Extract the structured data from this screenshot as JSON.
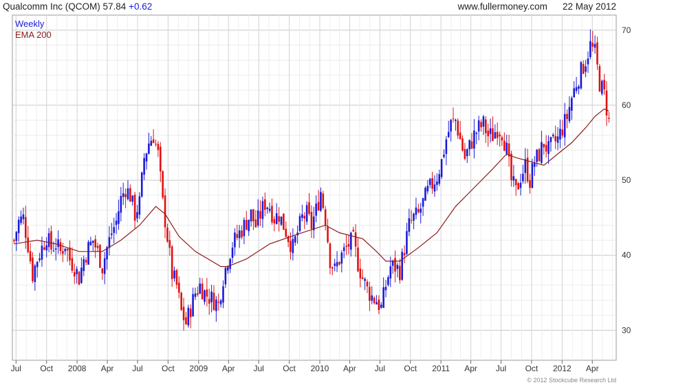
{
  "header": {
    "symbol_title": "Qualcomm Inc (QCOM)",
    "last_price": "57.84",
    "change": "+0.62",
    "site": "www.fullermoney.com",
    "date": "22 May 2012"
  },
  "copyright": "© 2012 Stockcube Research Ltd",
  "colors": {
    "up": "#1a1ad8",
    "down": "#e01010",
    "ema": "#8b1a1a",
    "grid": "#dcdcdc",
    "border": "#999999"
  },
  "chart_data": {
    "type": "candlestick",
    "legend": [
      {
        "label": "Weekly",
        "color": "#1a1ad8"
      },
      {
        "label": "EMA 200",
        "color": "#8b1a1a"
      }
    ],
    "legend_position": "top-left",
    "y_axis": {
      "position": "right",
      "min": 26,
      "max": 72,
      "ticks": [
        30,
        40,
        50,
        60,
        70
      ]
    },
    "x_axis": {
      "start": "2007-06-20",
      "end": "2012-06-12",
      "ticks": [
        {
          "date": "2007-07-01",
          "label": "Jul"
        },
        {
          "date": "2007-10-01",
          "label": "Oct"
        },
        {
          "date": "2008-01-01",
          "label": "2008"
        },
        {
          "date": "2008-04-01",
          "label": "Apr"
        },
        {
          "date": "2008-07-01",
          "label": "Jul"
        },
        {
          "date": "2008-10-01",
          "label": "Oct"
        },
        {
          "date": "2009-01-01",
          "label": "2009"
        },
        {
          "date": "2009-04-01",
          "label": "Apr"
        },
        {
          "date": "2009-07-01",
          "label": "Jul"
        },
        {
          "date": "2009-10-01",
          "label": "Oct"
        },
        {
          "date": "2010-01-01",
          "label": "2010"
        },
        {
          "date": "2010-04-01",
          "label": "Apr"
        },
        {
          "date": "2010-07-01",
          "label": "Jul"
        },
        {
          "date": "2010-10-01",
          "label": "Oct"
        },
        {
          "date": "2011-01-01",
          "label": "2011"
        },
        {
          "date": "2011-04-01",
          "label": "Apr"
        },
        {
          "date": "2011-07-01",
          "label": "Jul"
        },
        {
          "date": "2011-10-01",
          "label": "Oct"
        },
        {
          "date": "2012-01-01",
          "label": "2012"
        },
        {
          "date": "2012-04-01",
          "label": "Apr"
        }
      ]
    },
    "price_series": [
      [
        "2007-06-25",
        42.0
      ],
      [
        "2007-07-09",
        44.5
      ],
      [
        "2007-07-23",
        45.0
      ],
      [
        "2007-08-06",
        41.5
      ],
      [
        "2007-08-20",
        37.5
      ],
      [
        "2007-09-03",
        39.5
      ],
      [
        "2007-09-17",
        41.0
      ],
      [
        "2007-10-01",
        42.5
      ],
      [
        "2007-10-15",
        41.0
      ],
      [
        "2007-10-29",
        41.5
      ],
      [
        "2007-11-12",
        40.5
      ],
      [
        "2007-11-26",
        41.5
      ],
      [
        "2007-12-10",
        39.5
      ],
      [
        "2007-12-24",
        38.5
      ],
      [
        "2008-01-07",
        37.0
      ],
      [
        "2008-01-21",
        39.5
      ],
      [
        "2008-02-04",
        41.0
      ],
      [
        "2008-02-18",
        42.0
      ],
      [
        "2008-03-03",
        40.5
      ],
      [
        "2008-03-17",
        38.5
      ],
      [
        "2008-03-31",
        41.0
      ],
      [
        "2008-04-14",
        43.0
      ],
      [
        "2008-04-28",
        44.5
      ],
      [
        "2008-05-12",
        47.5
      ],
      [
        "2008-05-26",
        49.0
      ],
      [
        "2008-06-09",
        48.0
      ],
      [
        "2008-06-23",
        45.5
      ],
      [
        "2008-07-07",
        47.0
      ],
      [
        "2008-07-21",
        53.0
      ],
      [
        "2008-08-04",
        55.0
      ],
      [
        "2008-08-18",
        56.0
      ],
      [
        "2008-09-01",
        53.5
      ],
      [
        "2008-09-15",
        47.0
      ],
      [
        "2008-09-29",
        42.5
      ],
      [
        "2008-10-13",
        37.5
      ],
      [
        "2008-10-27",
        36.0
      ],
      [
        "2008-11-10",
        32.5
      ],
      [
        "2008-11-24",
        31.0
      ],
      [
        "2008-12-08",
        33.0
      ],
      [
        "2008-12-22",
        35.0
      ],
      [
        "2009-01-05",
        36.0
      ],
      [
        "2009-01-19",
        35.0
      ],
      [
        "2009-02-02",
        34.5
      ],
      [
        "2009-02-16",
        34.0
      ],
      [
        "2009-03-02",
        33.5
      ],
      [
        "2009-03-16",
        37.0
      ],
      [
        "2009-03-30",
        39.5
      ],
      [
        "2009-04-13",
        41.5
      ],
      [
        "2009-04-27",
        42.5
      ],
      [
        "2009-05-11",
        43.5
      ],
      [
        "2009-05-25",
        44.5
      ],
      [
        "2009-06-08",
        45.5
      ],
      [
        "2009-06-22",
        44.0
      ],
      [
        "2009-07-06",
        45.5
      ],
      [
        "2009-07-20",
        47.0
      ],
      [
        "2009-08-03",
        46.5
      ],
      [
        "2009-08-17",
        45.0
      ],
      [
        "2009-08-31",
        45.5
      ],
      [
        "2009-09-14",
        44.0
      ],
      [
        "2009-09-28",
        42.5
      ],
      [
        "2009-10-12",
        41.0
      ],
      [
        "2009-10-26",
        43.0
      ],
      [
        "2009-11-09",
        45.0
      ],
      [
        "2009-11-23",
        45.5
      ],
      [
        "2009-12-07",
        44.0
      ],
      [
        "2009-12-21",
        46.0
      ],
      [
        "2010-01-04",
        48.5
      ],
      [
        "2010-01-18",
        45.0
      ],
      [
        "2010-02-01",
        39.5
      ],
      [
        "2010-02-15",
        38.0
      ],
      [
        "2010-03-01",
        39.5
      ],
      [
        "2010-03-15",
        40.5
      ],
      [
        "2010-03-29",
        41.5
      ],
      [
        "2010-04-12",
        42.0
      ],
      [
        "2010-04-26",
        39.0
      ],
      [
        "2010-05-10",
        37.0
      ],
      [
        "2010-05-24",
        35.5
      ],
      [
        "2010-06-07",
        34.5
      ],
      [
        "2010-06-21",
        34.0
      ],
      [
        "2010-07-05",
        33.0
      ],
      [
        "2010-07-19",
        36.0
      ],
      [
        "2010-08-02",
        38.5
      ],
      [
        "2010-08-16",
        38.5
      ],
      [
        "2010-08-30",
        38.0
      ],
      [
        "2010-09-13",
        41.0
      ],
      [
        "2010-09-27",
        44.0
      ],
      [
        "2010-10-11",
        45.0
      ],
      [
        "2010-10-25",
        45.5
      ],
      [
        "2010-11-08",
        47.0
      ],
      [
        "2010-11-22",
        48.5
      ],
      [
        "2010-12-06",
        49.5
      ],
      [
        "2010-12-20",
        50.5
      ],
      [
        "2011-01-03",
        52.5
      ],
      [
        "2011-01-17",
        55.5
      ],
      [
        "2011-01-31",
        57.5
      ],
      [
        "2011-02-14",
        58.0
      ],
      [
        "2011-02-28",
        55.5
      ],
      [
        "2011-03-14",
        53.0
      ],
      [
        "2011-03-28",
        54.5
      ],
      [
        "2011-04-11",
        56.0
      ],
      [
        "2011-04-25",
        57.0
      ],
      [
        "2011-05-09",
        57.5
      ],
      [
        "2011-05-23",
        56.0
      ],
      [
        "2011-06-06",
        56.0
      ],
      [
        "2011-06-20",
        57.0
      ],
      [
        "2011-07-04",
        56.5
      ],
      [
        "2011-07-18",
        54.0
      ],
      [
        "2011-08-01",
        50.0
      ],
      [
        "2011-08-15",
        48.5
      ],
      [
        "2011-08-29",
        50.5
      ],
      [
        "2011-09-12",
        52.0
      ],
      [
        "2011-09-26",
        50.0
      ],
      [
        "2011-10-10",
        52.5
      ],
      [
        "2011-10-24",
        53.5
      ],
      [
        "2011-11-07",
        55.0
      ],
      [
        "2011-11-21",
        54.0
      ],
      [
        "2011-12-05",
        55.0
      ],
      [
        "2011-12-19",
        55.5
      ],
      [
        "2012-01-02",
        57.0
      ],
      [
        "2012-01-16",
        58.5
      ],
      [
        "2012-01-30",
        61.0
      ],
      [
        "2012-02-13",
        63.0
      ],
      [
        "2012-02-27",
        64.5
      ],
      [
        "2012-03-12",
        66.0
      ],
      [
        "2012-03-26",
        68.0
      ],
      [
        "2012-04-09",
        67.0
      ],
      [
        "2012-04-23",
        63.0
      ],
      [
        "2012-05-07",
        61.5
      ],
      [
        "2012-05-21",
        57.84
      ]
    ],
    "ema_series": [
      [
        "2007-06-25",
        41.5
      ],
      [
        "2007-09-03",
        42.0
      ],
      [
        "2007-10-29",
        41.5
      ],
      [
        "2008-01-07",
        40.5
      ],
      [
        "2008-03-17",
        40.5
      ],
      [
        "2008-05-12",
        42.0
      ],
      [
        "2008-07-07",
        44.0
      ],
      [
        "2008-08-25",
        46.5
      ],
      [
        "2008-09-22",
        45.5
      ],
      [
        "2008-11-03",
        42.5
      ],
      [
        "2008-12-22",
        40.5
      ],
      [
        "2009-03-09",
        38.5
      ],
      [
        "2009-03-30",
        38.5
      ],
      [
        "2009-05-25",
        39.5
      ],
      [
        "2009-08-03",
        41.5
      ],
      [
        "2009-10-26",
        42.8
      ],
      [
        "2010-01-18",
        44.0
      ],
      [
        "2010-03-01",
        43.0
      ],
      [
        "2010-05-10",
        42.2
      ],
      [
        "2010-06-21",
        40.5
      ],
      [
        "2010-07-19",
        39.2
      ],
      [
        "2010-08-30",
        39.2
      ],
      [
        "2010-10-25",
        41.0
      ],
      [
        "2010-12-20",
        43.0
      ],
      [
        "2011-02-14",
        46.5
      ],
      [
        "2011-04-11",
        49.0
      ],
      [
        "2011-06-06",
        51.5
      ],
      [
        "2011-07-18",
        53.5
      ],
      [
        "2011-08-15",
        53.0
      ],
      [
        "2011-09-26",
        52.5
      ],
      [
        "2011-11-07",
        52.0
      ],
      [
        "2011-12-19",
        53.5
      ],
      [
        "2012-01-30",
        55.0
      ],
      [
        "2012-03-12",
        57.0
      ],
      [
        "2012-04-09",
        58.5
      ],
      [
        "2012-05-07",
        59.5
      ],
      [
        "2012-05-21",
        59.2
      ]
    ]
  }
}
